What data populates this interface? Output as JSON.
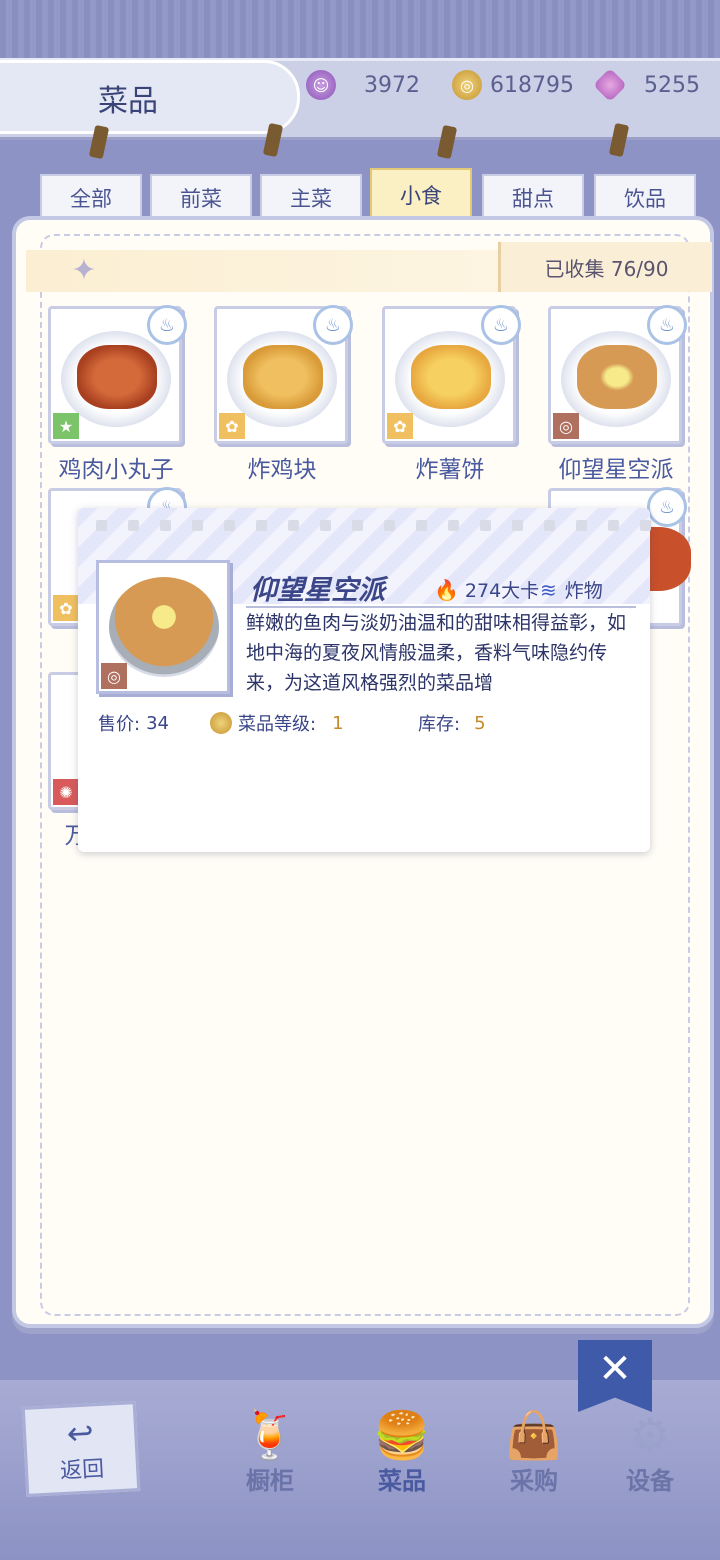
{
  "header": {
    "title": "菜品",
    "currencies": [
      {
        "name": "purple-gem",
        "value": "3972"
      },
      {
        "name": "gold-coin",
        "value": "618795"
      },
      {
        "name": "diamond",
        "value": "5255"
      }
    ]
  },
  "tabs": [
    {
      "label": "全部"
    },
    {
      "label": "前菜"
    },
    {
      "label": "主菜"
    },
    {
      "label": "小食",
      "active": true
    },
    {
      "label": "甜点"
    },
    {
      "label": "饮品"
    }
  ],
  "collection": {
    "label": "已收集 76/90"
  },
  "dishes": [
    {
      "name": "鸡肉小丸子",
      "badge_color": "#7cc46a"
    },
    {
      "name": "炸鸡块",
      "badge_color": "#f0c060"
    },
    {
      "name": "炸薯饼",
      "badge_color": "#f0c060"
    },
    {
      "name": "仰望星空派",
      "badge_color": "#b07060"
    }
  ],
  "partial_dish_name": "万",
  "popup": {
    "name": "仰望星空派",
    "calories": "274大卡",
    "type": "炸物",
    "description": "鲜嫩的鱼肉与淡奶油温和的甜味相得益彰，如地中海的夏夜风情般温柔，香料气味隐约传来，为这道风格强烈的菜品增",
    "price_label": "售价:",
    "price_value": "34",
    "level_label": "菜品等级:",
    "level_value": "1",
    "stock_label": "库存:",
    "stock_value": "5"
  },
  "close_label": "✕",
  "nav": {
    "back": "返回",
    "items": [
      {
        "label": "橱柜",
        "icon": "cabinet-icon"
      },
      {
        "label": "菜品",
        "icon": "burger-icon",
        "active": true
      },
      {
        "label": "采购",
        "icon": "shopping-bag-icon"
      },
      {
        "label": "设备",
        "icon": "mixer-icon"
      }
    ]
  },
  "colors": {
    "accent": "#3f5aa8",
    "tab_active": "#fbefc4",
    "value_orange": "#c68a2a"
  }
}
